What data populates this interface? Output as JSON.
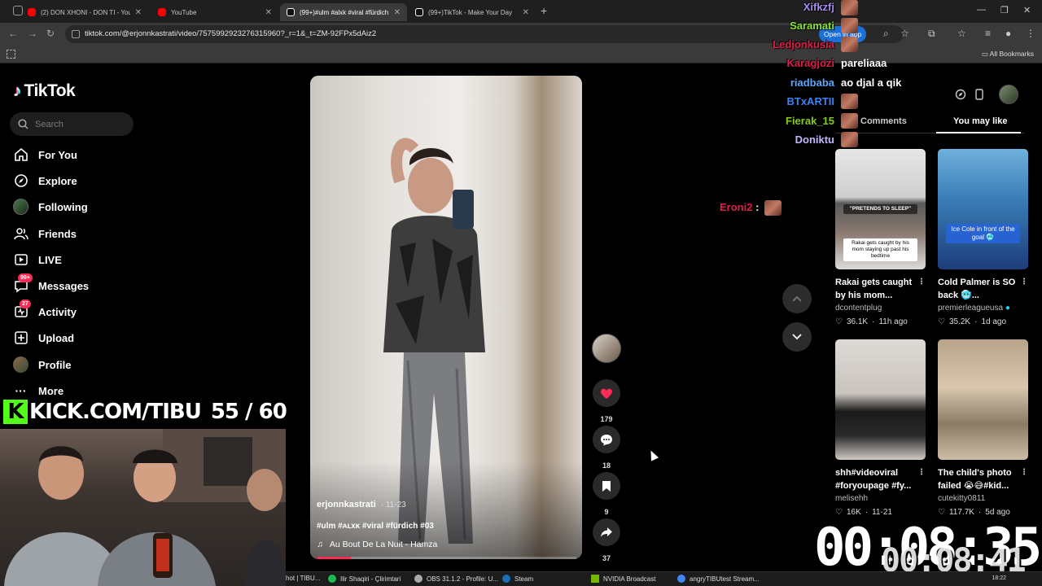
{
  "browser": {
    "tabs": [
      {
        "title": "(2) DON XHONI - DON TI - YouTube",
        "favicon_color": "#ff0000",
        "active": false
      },
      {
        "title": "YouTube",
        "favicon_color": "#ff0000",
        "active": false
      },
      {
        "title": "(99+)#ulm #alxk #viral #fürdich",
        "favicon_color": "#ffffff",
        "active": true
      },
      {
        "title": "(99+)TikTok - Make Your Day",
        "favicon_color": "#ffffff",
        "active": false
      }
    ],
    "url": "tiktok.com/@erjonnkastrati/video/7575992923276315960?_r=1&_t=ZM-92FPx5dAiz2",
    "open_in_app": "Open in app",
    "all_bookmarks": "All Bookmarks"
  },
  "tiktok": {
    "logo_text": "TikTok",
    "search_placeholder": "Search",
    "menu": [
      {
        "label": "For You",
        "icon": "home-icon"
      },
      {
        "label": "Explore",
        "icon": "compass-icon"
      },
      {
        "label": "Following",
        "icon": "avatar-icon"
      },
      {
        "label": "Friends",
        "icon": "friends-icon"
      },
      {
        "label": "LIVE",
        "icon": "live-icon"
      },
      {
        "label": "Messages",
        "icon": "messages-icon",
        "badge": "99+"
      },
      {
        "label": "Activity",
        "icon": "activity-icon",
        "badge": "27"
      },
      {
        "label": "Upload",
        "icon": "upload-icon"
      },
      {
        "label": "Profile",
        "icon": "profile-icon"
      },
      {
        "label": "More",
        "icon": "more-icon"
      }
    ],
    "video": {
      "author": "erjonnkastrati",
      "date": "· 11-23",
      "tags": "#ulm #ᴀʟxᴋ #viral #fürdich #03",
      "music": "Au Bout De La Nuit - Hamza",
      "progress": 0.13
    },
    "actions": {
      "likes": "179",
      "comments": "18",
      "saves": "9",
      "shares": "37"
    },
    "right_panel": {
      "tab_comments": "Comments",
      "tab_you_may_like": "You may like",
      "cards": [
        {
          "title": "Rakai gets caught by his mom...",
          "caption_top": "\"PRETENDS TO SLEEP\"",
          "caption": "Rakai gets caught by his mom staying up past his bedtime",
          "author": "dcontentplug",
          "verified": false,
          "likes": "36.1K",
          "age": "11h ago"
        },
        {
          "title": "Cold Palmer is SO back 🥶...",
          "caption": "Ice Cole in front of the goal 🥶",
          "author": "premierleagueusa",
          "verified": true,
          "likes": "35.2K",
          "age": "1d ago"
        },
        {
          "title": "shh#videoviral #foryoupage #fy...",
          "author": "melisehh",
          "verified": false,
          "likes": "16K",
          "age": "11-21"
        },
        {
          "title": "The child's photo failed 😭😅#kid...",
          "author": "cutekitty0811",
          "verified": false,
          "likes": "117.7K",
          "age": "5d ago"
        }
      ]
    }
  },
  "stream_overlay": {
    "chat": [
      {
        "name": "Xifkzfj",
        "color": "#a78bfa",
        "message": ""
      },
      {
        "name": "Saramati",
        "color": "#8ae234",
        "message": ""
      },
      {
        "name": "Ledjonkusia",
        "color": "#e11d48",
        "message": ""
      },
      {
        "name": "Karagjozi",
        "color": "#e11d48",
        "message": "pareliaaa"
      },
      {
        "name": "riadbaba",
        "color": "#60a5fa",
        "message": "ao djal a qik"
      },
      {
        "name": "BTxARTII",
        "color": "#3b82f6",
        "message": ""
      },
      {
        "name": "Fierak_15",
        "color": "#84cc16",
        "message": ""
      },
      {
        "name": "Doniktu",
        "color": "#c4b5fd",
        "message": ""
      }
    ],
    "side_chat": {
      "name": "Eroni2",
      "color": "#e11d48",
      "separator": ":"
    },
    "kick_text": "KICK.COM/TIBU",
    "kick_counter": "55 / 60",
    "timer_big": "00:08:35",
    "timer_small": "00:08:41"
  },
  "taskbar": {
    "items": [
      {
        "label": "hot | TIBU...",
        "color": "#5a5a5a"
      },
      {
        "label": "Ilir Shaqiri - Çlirimtari",
        "color": "#1db954"
      },
      {
        "label": "OBS 31.1.2 - Profile: U...",
        "color": "#aaaaaa"
      },
      {
        "label": "Steam",
        "color": "#1b6fb8"
      },
      {
        "label": "NVIDIA Broadcast",
        "color": "#76b900"
      },
      {
        "label": "angryTIBUtest Stream...",
        "color": "#4285f4"
      }
    ],
    "clock": "18:22"
  }
}
